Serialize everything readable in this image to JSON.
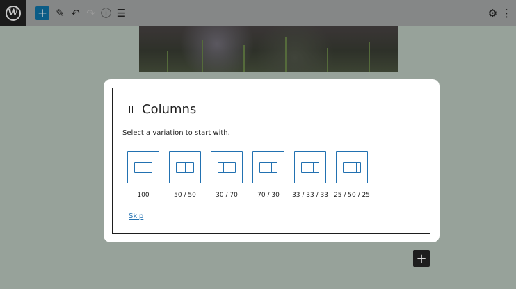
{
  "toolbar": {
    "logo_letter": "W",
    "add_glyph": "+",
    "edit_glyph": "✎",
    "undo_glyph": "↶",
    "redo_glyph": "↷",
    "info_glyph": "ⓘ",
    "list_glyph": "☰",
    "settings_glyph": "⚙",
    "more_glyph": "⋮"
  },
  "placeholder": {
    "title": "Columns",
    "instructions": "Select a variation to start with.",
    "variations": [
      {
        "label": "100",
        "parts": [
          1
        ]
      },
      {
        "label": "50 / 50",
        "parts": [
          1,
          1
        ]
      },
      {
        "label": "30 / 70",
        "parts": [
          3,
          7
        ]
      },
      {
        "label": "70 / 30",
        "parts": [
          7,
          3
        ]
      },
      {
        "label": "33 / 33 / 33",
        "parts": [
          1,
          1,
          1
        ]
      },
      {
        "label": "25 / 50 / 25",
        "parts": [
          1,
          2,
          1
        ]
      }
    ],
    "skip_label": "Skip"
  },
  "inserter_glyph": "+",
  "colors": {
    "accent": "#2271b1",
    "overlay": "#97a29a",
    "toolbar_add": "#0b5c86"
  }
}
